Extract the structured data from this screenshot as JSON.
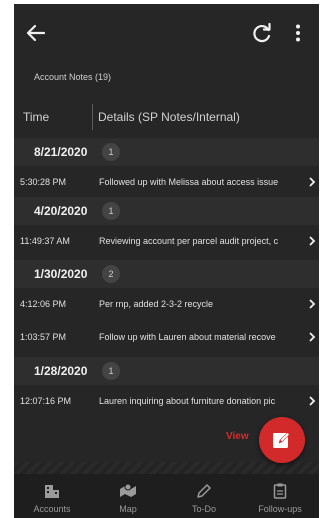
{
  "header": {
    "back_icon": "arrow-left-icon",
    "refresh_icon": "refresh-icon",
    "more_icon": "more-vertical-icon"
  },
  "subtitle": "Account Notes (19)",
  "columns": {
    "time": "Time",
    "details": "Details (SP Notes/Internal)"
  },
  "groups": [
    {
      "date": "8/21/2020",
      "count": "1",
      "notes": [
        {
          "time": "5:30:28 PM",
          "text": "Followed up with Melissa about access issue"
        }
      ]
    },
    {
      "date": "4/20/2020",
      "count": "1",
      "notes": [
        {
          "time": "11:49:37 AM",
          "text": "Reviewing account per parcel audit project, c"
        }
      ]
    },
    {
      "date": "1/30/2020",
      "count": "2",
      "notes": [
        {
          "time": "4:12:06 PM",
          "text": "Per rnp, added 2-3-2 recycle"
        },
        {
          "time": "1:03:57 PM",
          "text": "Follow up with Lauren about material recove"
        }
      ]
    },
    {
      "date": "1/28/2020",
      "count": "1",
      "notes": [
        {
          "time": "12:07:16 PM",
          "text": "Lauren inquiring about furniture donation pic"
        }
      ]
    }
  ],
  "fab": {
    "label": "View",
    "icon": "edit-note-icon"
  },
  "nav": [
    {
      "label": "Accounts",
      "icon": "accounts-icon"
    },
    {
      "label": "Map",
      "icon": "map-icon"
    },
    {
      "label": "To-Do",
      "icon": "pencil-icon"
    },
    {
      "label": "Follow-ups",
      "icon": "clipboard-icon"
    }
  ],
  "colors": {
    "background": "#262626",
    "accent": "#d22a2a",
    "nav_background": "#1e1e1e"
  }
}
